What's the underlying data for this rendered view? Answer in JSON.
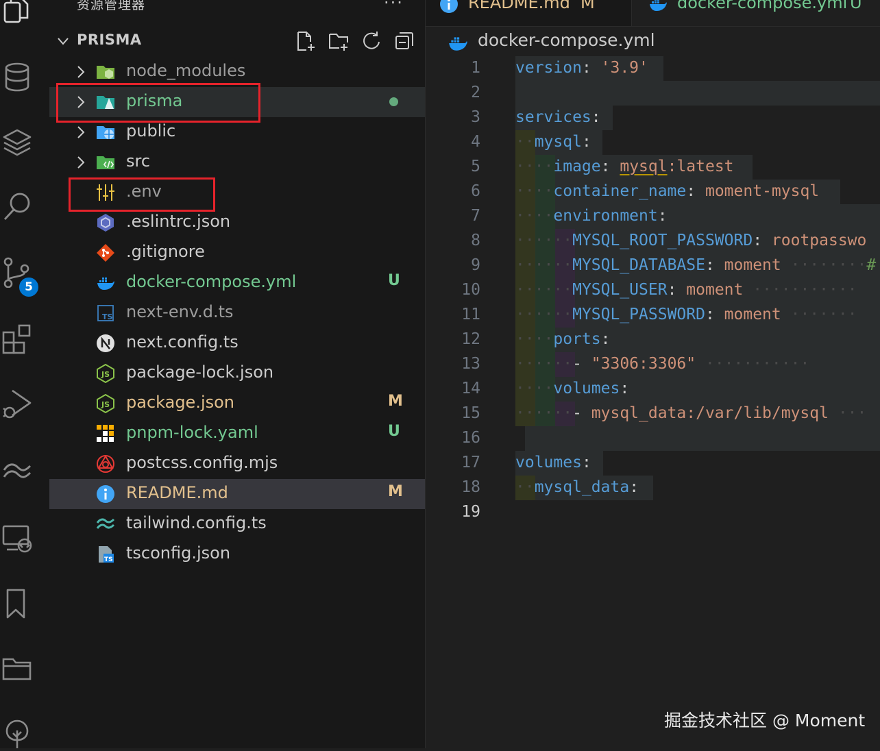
{
  "sidebar": {
    "title": "资源管理器",
    "more": "···",
    "project_name": "PRISMA",
    "scm_badge": "5",
    "items": [
      {
        "name": "node_modules",
        "kind": "folder",
        "color": "#9d9d9d",
        "status": "",
        "status_color": ""
      },
      {
        "name": "prisma",
        "kind": "folder",
        "color": "#73c991",
        "status": "dot",
        "status_color": "#73c991"
      },
      {
        "name": "public",
        "kind": "folder",
        "color": "#cccccc",
        "status": "",
        "status_color": ""
      },
      {
        "name": "src",
        "kind": "folder",
        "color": "#cccccc",
        "status": "",
        "status_color": ""
      },
      {
        "name": ".env",
        "kind": "file",
        "color": "#9d9d9d",
        "status": "",
        "status_color": ""
      },
      {
        "name": ".eslintrc.json",
        "kind": "file",
        "color": "#cccccc",
        "status": "",
        "status_color": ""
      },
      {
        "name": ".gitignore",
        "kind": "file",
        "color": "#cccccc",
        "status": "",
        "status_color": ""
      },
      {
        "name": "docker-compose.yml",
        "kind": "file",
        "color": "#73c991",
        "status": "U",
        "status_color": "#73c991"
      },
      {
        "name": "next-env.d.ts",
        "kind": "file",
        "color": "#9d9d9d",
        "status": "",
        "status_color": ""
      },
      {
        "name": "next.config.ts",
        "kind": "file",
        "color": "#cccccc",
        "status": "",
        "status_color": ""
      },
      {
        "name": "package-lock.json",
        "kind": "file",
        "color": "#cccccc",
        "status": "",
        "status_color": ""
      },
      {
        "name": "package.json",
        "kind": "file",
        "color": "#e2c08d",
        "status": "M",
        "status_color": "#e2c08d"
      },
      {
        "name": "pnpm-lock.yaml",
        "kind": "file",
        "color": "#73c991",
        "status": "U",
        "status_color": "#73c991"
      },
      {
        "name": "postcss.config.mjs",
        "kind": "file",
        "color": "#cccccc",
        "status": "",
        "status_color": ""
      },
      {
        "name": "README.md",
        "kind": "file",
        "color": "#e2c08d",
        "status": "M",
        "status_color": "#e2c08d"
      },
      {
        "name": "tailwind.config.ts",
        "kind": "file",
        "color": "#cccccc",
        "status": "",
        "status_color": ""
      },
      {
        "name": "tsconfig.json",
        "kind": "file",
        "color": "#cccccc",
        "status": "",
        "status_color": ""
      }
    ]
  },
  "tabs": [
    {
      "label": "README.md",
      "status": "M",
      "color": "#e2c08d"
    },
    {
      "label": "docker-compose.yml",
      "status": "U",
      "color": "#73c991"
    }
  ],
  "breadcrumb": "docker-compose.yml",
  "code": {
    "active_line": "19",
    "lines": [
      "1",
      "2",
      "3",
      "4",
      "5",
      "6",
      "7",
      "8",
      "9",
      "10",
      "11",
      "12",
      "13",
      "14",
      "15",
      "16",
      "17",
      "18",
      "19"
    ],
    "tokens": {
      "l1_k": "version",
      "l1_p": ": ",
      "l1_s": "'3.9'",
      "l3_k": "services",
      "l3_p": ":",
      "l4_k": "mysql",
      "l4_p": ":",
      "l5_k": "image",
      "l5_p": ": ",
      "l5_s1": "mysql",
      "l5_s2": ":latest",
      "l6_k": "container_name",
      "l6_p": ": ",
      "l6_s": "moment-mysql",
      "l7_k": "environment",
      "l7_p": ":",
      "l8_k": "MYSQL_ROOT_PASSWORD",
      "l8_p": ": ",
      "l8_s": "rootpasswo",
      "l9_k": "MYSQL_DATABASE",
      "l9_p": ": ",
      "l9_s": "moment",
      "l9_c": "#",
      "l10_k": "MYSQL_USER",
      "l10_p": ": ",
      "l10_s": "moment",
      "l11_k": "MYSQL_PASSWORD",
      "l11_p": ": ",
      "l11_s": "moment",
      "l12_k": "ports",
      "l12_p": ":",
      "l13_p": "- ",
      "l13_s": "\"3306:3306\"",
      "l14_k": "volumes",
      "l14_p": ":",
      "l15_p": "- ",
      "l15_s": "mysql_data:/var/lib/mysql",
      "l17_k": "volumes",
      "l17_p": ":",
      "l18_k": "mysql_data",
      "l18_p": ":"
    }
  },
  "watermark": "掘金技术社区 @ Moment"
}
